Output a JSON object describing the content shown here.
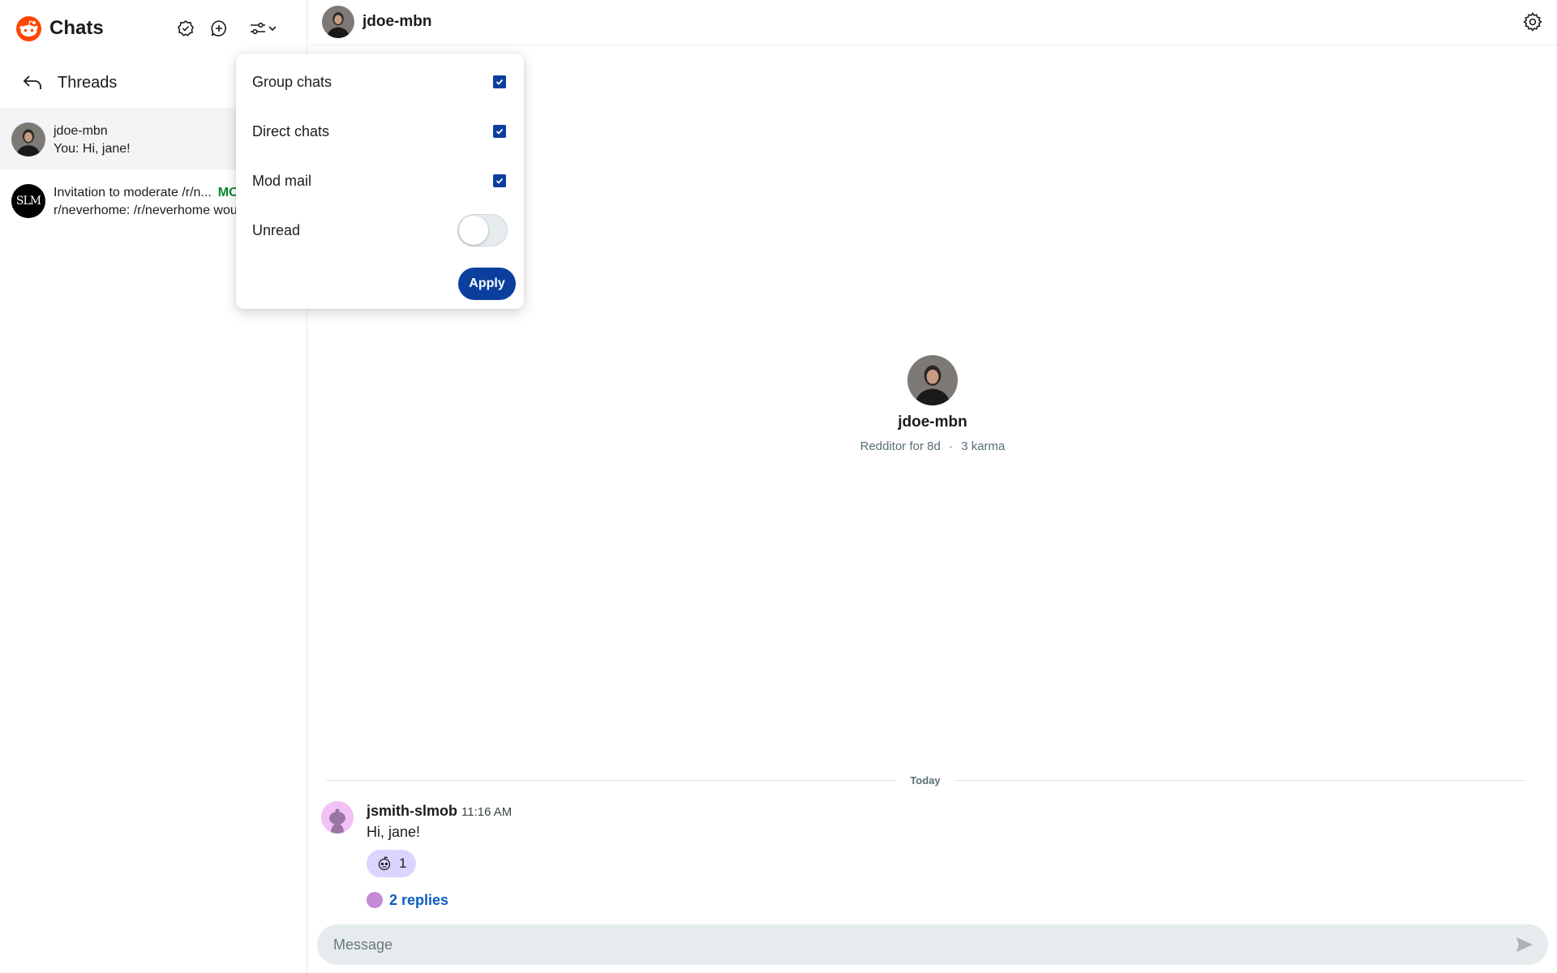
{
  "sidebar": {
    "title": "Chats",
    "threads_label": "Threads",
    "chats": [
      {
        "name": "jdoe-mbn",
        "preview": "You: Hi, jane!"
      },
      {
        "name": "Invitation to moderate /r/n...",
        "tag": "MO",
        "preview": "r/neverhome: /r/neverhome wou"
      }
    ],
    "logo_avatar_text": "SLM"
  },
  "filter": {
    "options": [
      {
        "label": "Group chats",
        "checked": true
      },
      {
        "label": "Direct chats",
        "checked": true
      },
      {
        "label": "Mod mail",
        "checked": true
      }
    ],
    "unread_label": "Unread",
    "unread_on": false,
    "apply_label": "Apply"
  },
  "conversation": {
    "header_name": "jdoe-mbn",
    "profile": {
      "name": "jdoe-mbn",
      "age": "Redditor for 8d",
      "karma": "3 karma",
      "separator": "·"
    },
    "day_label": "Today",
    "message": {
      "author": "jsmith-slmob",
      "time": "11:16 AM",
      "text": "Hi, jane!",
      "reaction_count": "1",
      "replies_label": "2 replies"
    },
    "composer_placeholder": "Message"
  },
  "colors": {
    "accent": "#0b3f9e",
    "brand": "#ff4500",
    "link": "#0a5dc2",
    "mod_tag": "#0b8a2b",
    "reaction_bg": "#dcd3ff"
  }
}
